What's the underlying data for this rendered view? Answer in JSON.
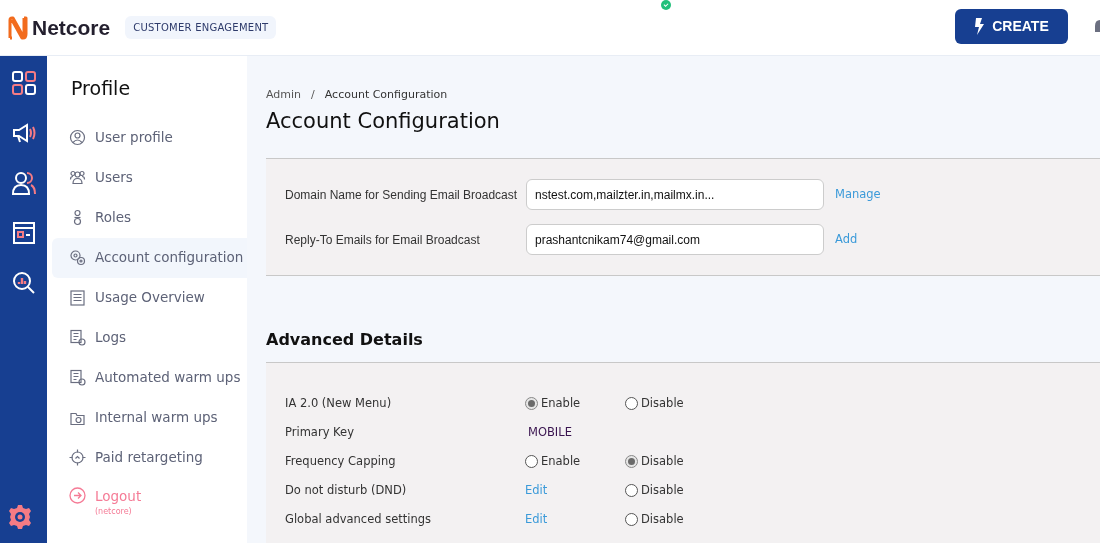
{
  "header": {
    "logo_text": "Netcore",
    "product_badge": "CUSTOMER ENGAGEMENT",
    "create_button": "CREATE"
  },
  "sidebar": {
    "title": "Profile",
    "items": [
      {
        "label": "User profile",
        "selected": false
      },
      {
        "label": "Users",
        "selected": false
      },
      {
        "label": "Roles",
        "selected": false
      },
      {
        "label": "Account configuration",
        "selected": true
      },
      {
        "label": "Usage Overview",
        "selected": false
      },
      {
        "label": "Logs",
        "selected": false
      },
      {
        "label": "Automated warm ups",
        "selected": false
      },
      {
        "label": "Internal warm ups",
        "selected": false
      },
      {
        "label": "Paid retargeting",
        "selected": false
      }
    ],
    "logout": {
      "label": "Logout",
      "sublabel": "(netcore)"
    }
  },
  "breadcrumb": {
    "items": [
      "Admin",
      "Account Configuration"
    ],
    "separator": "/"
  },
  "page_title": "Account Configuration",
  "email_settings": [
    {
      "label": "Domain Name for Sending Email Broadcast",
      "value": "nstest.com,mailzter.in,mailmx.in...",
      "action": "Manage"
    },
    {
      "label": "Reply-To Emails for Email Broadcast",
      "value": "prashantcnikam74@gmail.com",
      "action": "Add"
    }
  ],
  "advanced": {
    "title": "Advanced Details",
    "rows": [
      {
        "label": "IA 2.0 (New Menu)",
        "cells": [
          {
            "kind": "radio",
            "label": "Enable",
            "selected": true
          },
          {
            "kind": "radio",
            "label": "Disable",
            "selected": false
          }
        ]
      },
      {
        "label": "Primary Key",
        "cells": [
          {
            "kind": "text",
            "text": "MOBILE"
          }
        ]
      },
      {
        "label": "Frequency Capping",
        "cells": [
          {
            "kind": "radio",
            "label": "Enable",
            "selected": false
          },
          {
            "kind": "radio",
            "label": "Disable",
            "selected": true
          }
        ]
      },
      {
        "label": "Do not disturb (DND)",
        "cells": [
          {
            "kind": "link",
            "text": "Edit"
          },
          {
            "kind": "radio",
            "label": "Disable",
            "selected": false
          }
        ]
      },
      {
        "label": "Global advanced settings",
        "cells": [
          {
            "kind": "link",
            "text": "Edit"
          },
          {
            "kind": "radio",
            "label": "Disable",
            "selected": false
          }
        ]
      }
    ]
  }
}
